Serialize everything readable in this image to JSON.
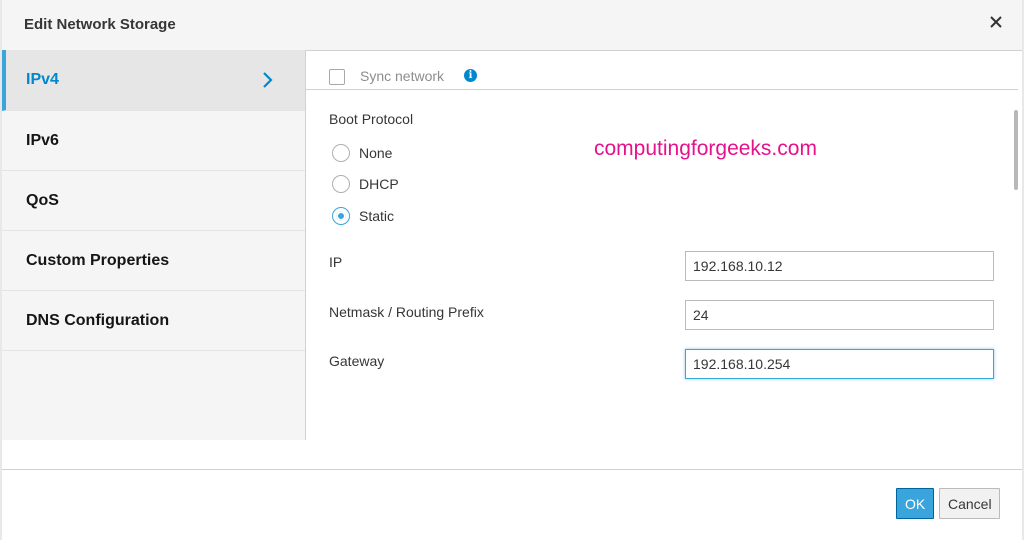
{
  "dialog": {
    "title": "Edit Network Storage",
    "close_icon": "close-icon"
  },
  "sidebar": {
    "items": [
      {
        "label": "IPv4",
        "active": true
      },
      {
        "label": "IPv6",
        "active": false
      },
      {
        "label": "QoS",
        "active": false
      },
      {
        "label": "Custom Properties",
        "active": false
      },
      {
        "label": "DNS Configuration",
        "active": false
      }
    ],
    "active_icon": "chevron-right-icon"
  },
  "form": {
    "sync_network": {
      "label": "Sync network",
      "checked": false,
      "info_icon": "info-icon"
    },
    "boot_protocol": {
      "label": "Boot Protocol",
      "options": [
        "None",
        "DHCP",
        "Static"
      ],
      "selected": "Static"
    },
    "ip": {
      "label": "IP",
      "value": "192.168.10.12"
    },
    "netmask": {
      "label": "Netmask / Routing Prefix",
      "value": "24"
    },
    "gateway": {
      "label": "Gateway",
      "value": "192.168.10.254"
    }
  },
  "watermark": "computingforgeeks.com",
  "footer": {
    "ok_label": "OK",
    "cancel_label": "Cancel"
  },
  "colors": {
    "accent": "#39a5dc",
    "active_text": "#0088ce",
    "watermark": "#e6128c"
  }
}
